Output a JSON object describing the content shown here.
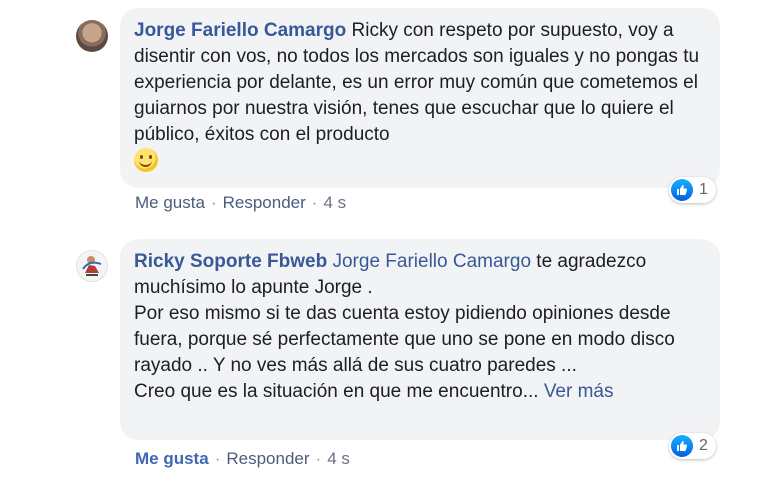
{
  "comments": [
    {
      "author": "Jorge Fariello Camargo",
      "text": "Ricky con respeto por supuesto, voy a disentir con vos, no todos los mercados son iguales y no pongas tu experiencia por delante, es un error muy común que cometemos el guiarnos por nuestra visión, tenes que escuchar que lo quiere el público, éxitos con el producto",
      "emoji": "slightly-smiling-face-icon",
      "actions": {
        "like": "Me gusta",
        "reply": "Responder",
        "time": "4 s"
      },
      "reaction_count": "1"
    },
    {
      "author": "Ricky Soporte Fbweb",
      "mention": "Jorge Fariello Camargo",
      "text_line1": "te agradezco muchísimo lo apunte Jorge .",
      "text_line2": "Por eso mismo si te das cuenta estoy pidiendo opiniones desde fuera, porque sé perfectamente que uno se pone en modo disco rayado .. Y no ves más allá de sus cuatro paredes ...",
      "text_line3": "Creo que es la situación en que me encuentro...",
      "see_more": "Ver más",
      "actions": {
        "like": "Me gusta",
        "reply": "Responder",
        "time": "4 s"
      },
      "reaction_count": "2"
    }
  ],
  "colors": {
    "author_link": "#385898",
    "bubble_bg": "#f2f3f5",
    "like_blue": "#4267b2"
  }
}
